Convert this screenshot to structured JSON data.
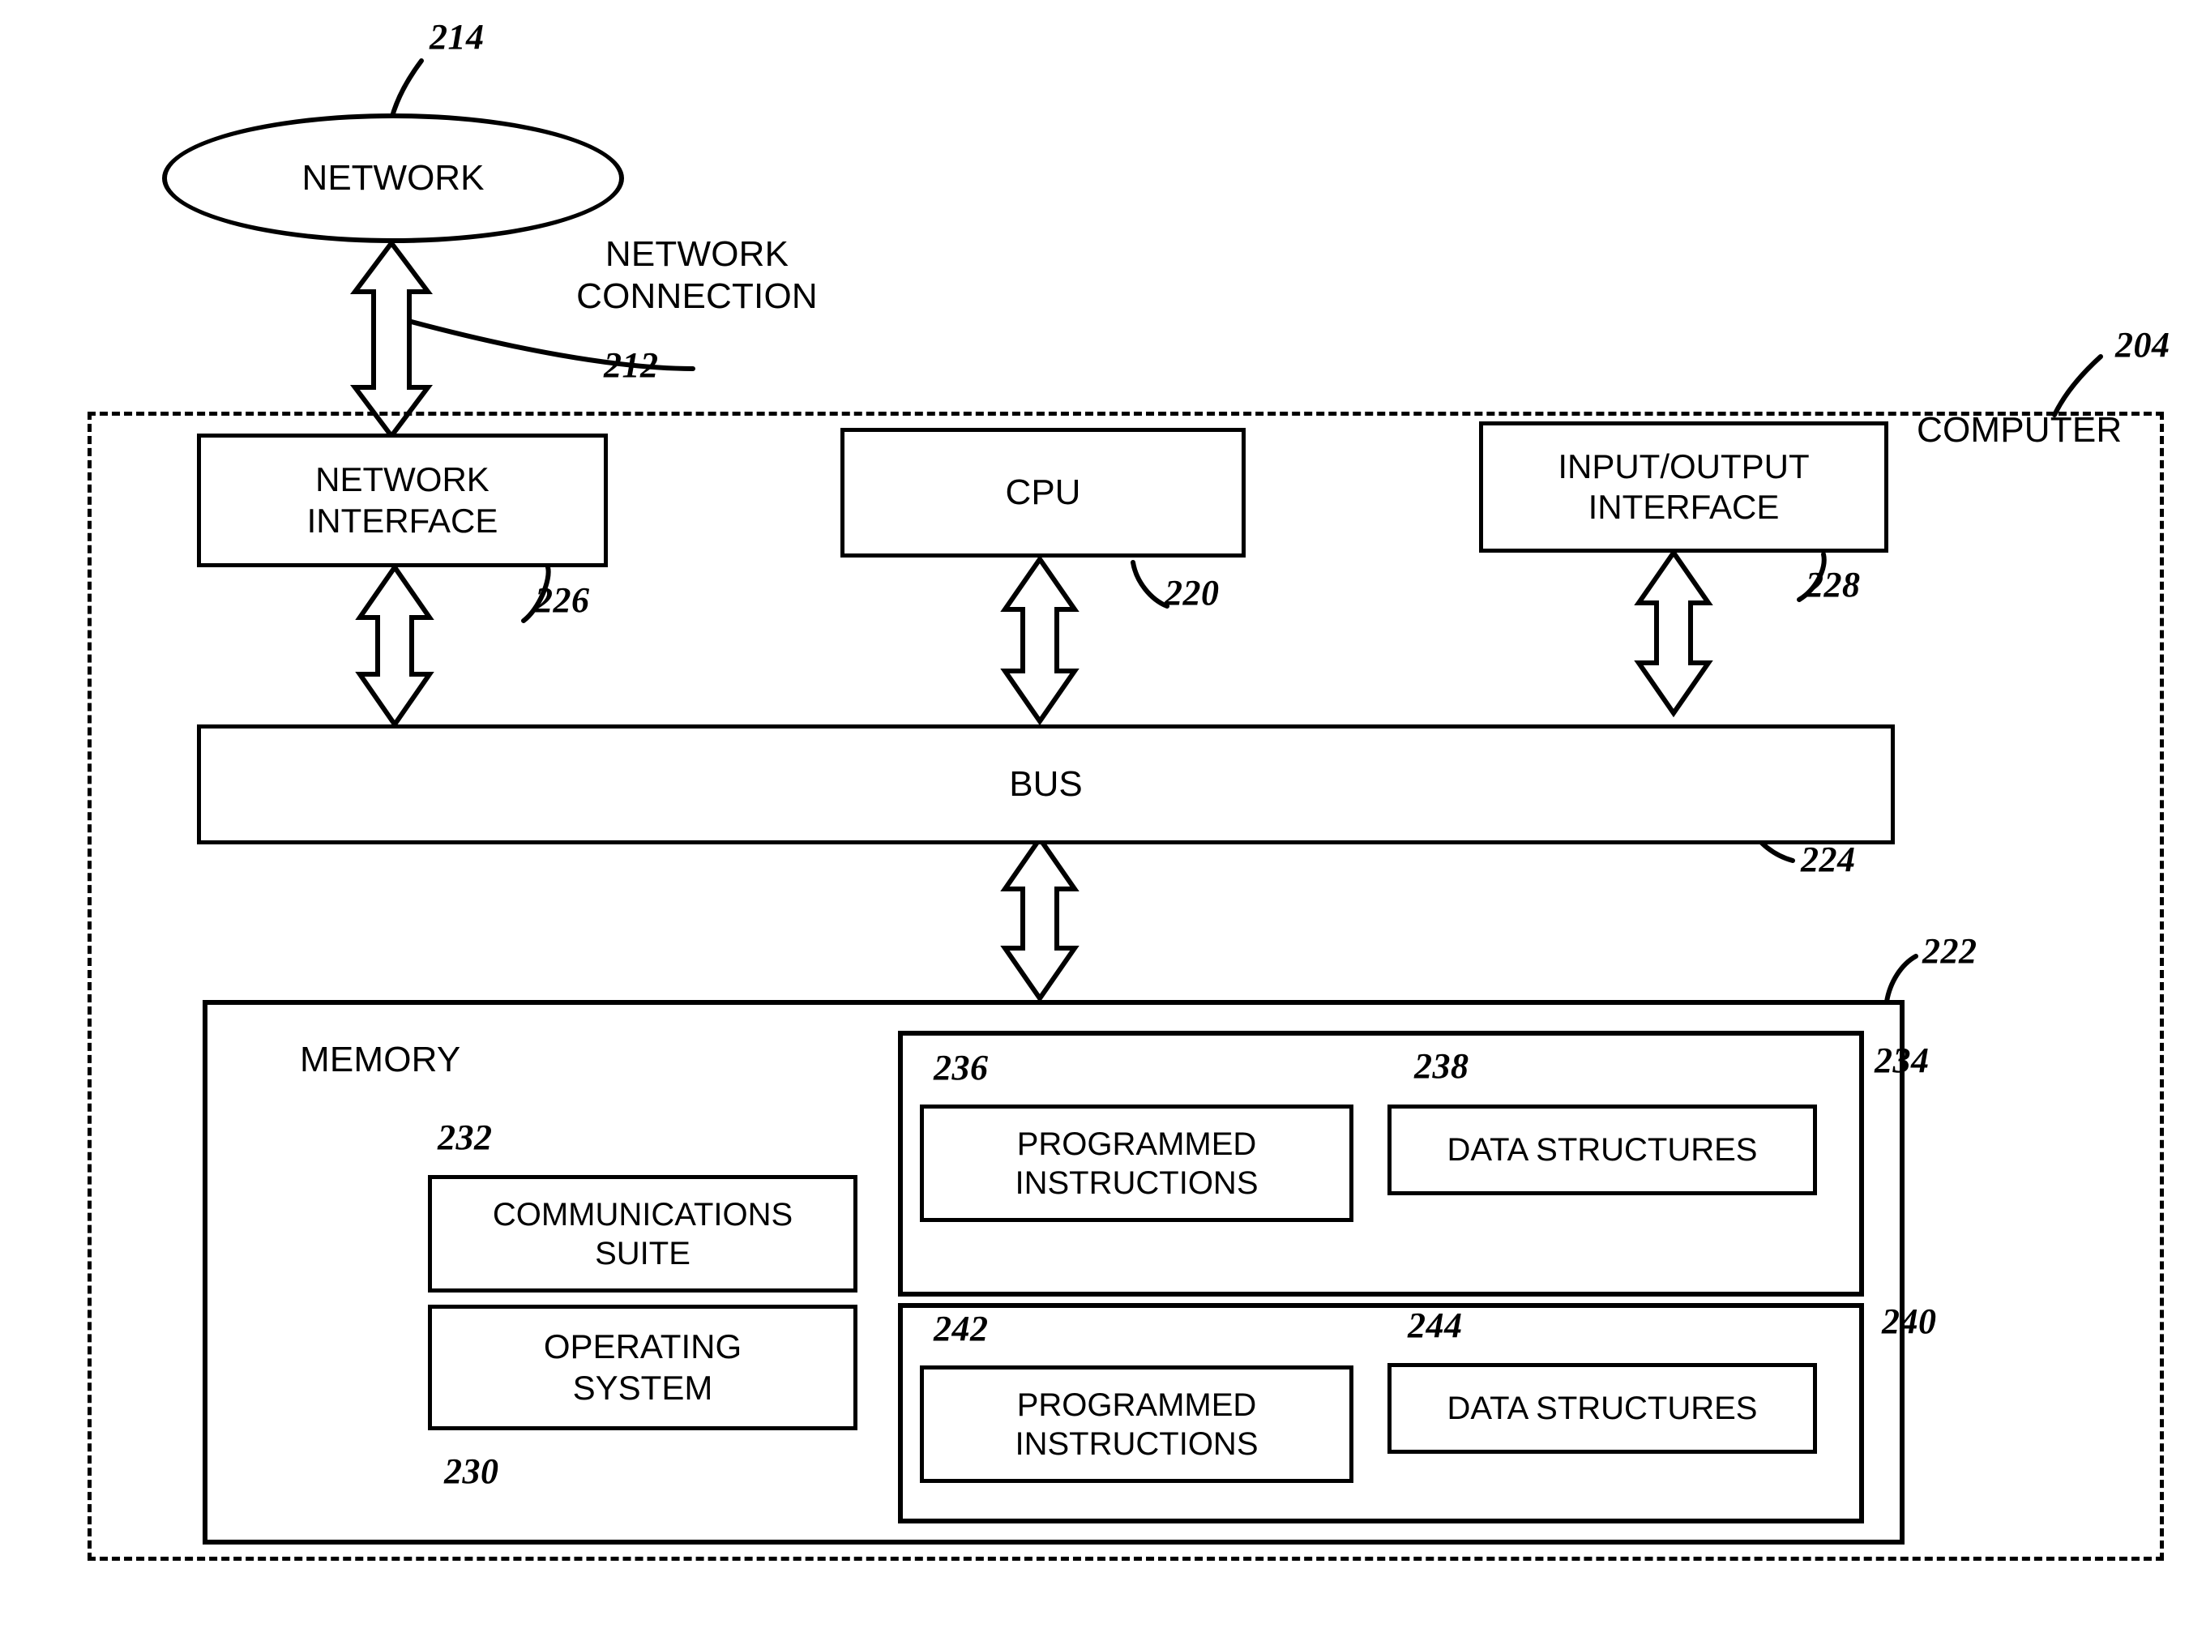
{
  "figure": {
    "type": "patent-block-diagram",
    "title": "Computer system block diagram"
  },
  "nodes": {
    "network": {
      "label": "NETWORK",
      "ref": "214"
    },
    "network_connection": {
      "label": "NETWORK\nCONNECTION",
      "ref": "212"
    },
    "computer": {
      "label": "COMPUTER",
      "ref": "204"
    },
    "network_interface": {
      "label": "NETWORK\nINTERFACE",
      "ref": "226"
    },
    "cpu": {
      "label": "CPU",
      "ref": "220"
    },
    "io_interface": {
      "label": "INPUT/OUTPUT\nINTERFACE",
      "ref": "228"
    },
    "bus": {
      "label": "BUS",
      "ref": "224"
    },
    "memory": {
      "label": "MEMORY",
      "ref": "222"
    },
    "communications_suite": {
      "label": "COMMUNICATIONS\nSUITE",
      "ref": "232"
    },
    "operating_system": {
      "label": "OPERATING\nSYSTEM",
      "ref": "230"
    },
    "module_a": {
      "ref": "234",
      "programmed_instructions": {
        "label": "PROGRAMMED\nINSTRUCTIONS",
        "ref": "236"
      },
      "data_structures": {
        "label": "DATA STRUCTURES",
        "ref": "238"
      }
    },
    "module_b": {
      "ref": "240",
      "programmed_instructions": {
        "label": "PROGRAMMED\nINSTRUCTIONS",
        "ref": "242"
      },
      "data_structures": {
        "label": "DATA STRUCTURES",
        "ref": "244"
      }
    }
  },
  "connectors": [
    {
      "name": "network-to-network-interface",
      "kind": "double-arrow",
      "from": "network",
      "to": "network_interface"
    },
    {
      "name": "network-interface-to-bus",
      "kind": "double-arrow",
      "from": "network_interface",
      "to": "bus"
    },
    {
      "name": "cpu-to-bus",
      "kind": "double-arrow",
      "from": "cpu",
      "to": "bus"
    },
    {
      "name": "io-interface-to-bus",
      "kind": "double-arrow",
      "from": "io_interface",
      "to": "bus"
    },
    {
      "name": "bus-to-memory",
      "kind": "double-arrow",
      "from": "bus",
      "to": "memory"
    }
  ],
  "colors": {
    "stroke": "#000000",
    "background": "#ffffff"
  }
}
